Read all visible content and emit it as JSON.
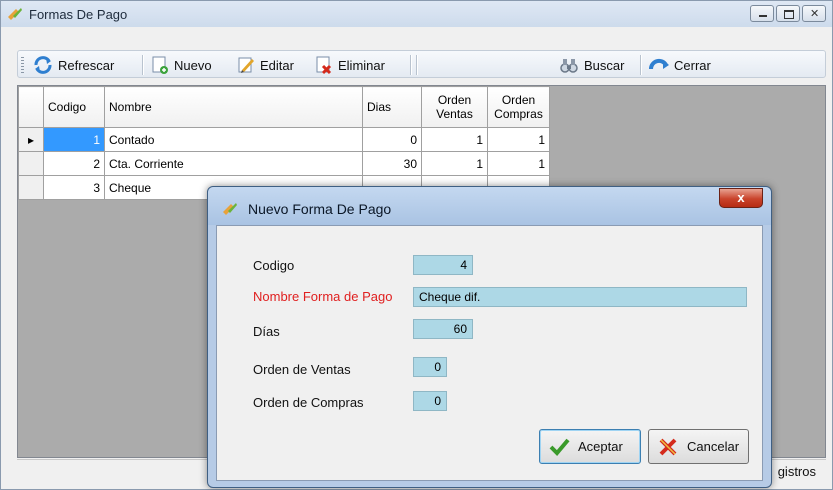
{
  "window": {
    "title": "Formas De Pago"
  },
  "toolbar": {
    "refresh_label": "Refrescar",
    "new_label": "Nuevo",
    "edit_label": "Editar",
    "delete_label": "Eliminar",
    "search_label": "Buscar",
    "close_label": "Cerrar"
  },
  "grid": {
    "columns": [
      "Codigo",
      "Nombre",
      "Dias",
      "Orden Ventas",
      "Orden Compras"
    ],
    "rows": [
      {
        "codigo": "1",
        "nombre": "Contado",
        "dias": "0",
        "orden_ventas": "1",
        "orden_compras": "1"
      },
      {
        "codigo": "2",
        "nombre": "Cta. Corriente",
        "dias": "30",
        "orden_ventas": "1",
        "orden_compras": "1"
      },
      {
        "codigo": "3",
        "nombre": "Cheque",
        "dias": "",
        "orden_ventas": "",
        "orden_compras": ""
      }
    ]
  },
  "status": {
    "text": "gistros"
  },
  "dialog": {
    "title": "Nuevo Forma De Pago",
    "close_glyph": "x",
    "fields": {
      "codigo": {
        "label": "Codigo",
        "value": "4"
      },
      "nombre": {
        "label": "Nombre Forma de Pago",
        "value": "Cheque dif."
      },
      "dias": {
        "label": "Días",
        "value": "60"
      },
      "orden_ventas": {
        "label": "Orden de Ventas",
        "value": "0"
      },
      "orden_compras": {
        "label": "Orden de Compras",
        "value": "0"
      }
    },
    "accept_label": "Aceptar",
    "cancel_label": "Cancelar"
  },
  "colors": {
    "required_label": "#e02020",
    "field_bg": "#add8e6",
    "selection": "#3399ff"
  },
  "icons": [
    "refresh-icon",
    "new-icon",
    "edit-icon",
    "delete-icon",
    "search-icon",
    "close-arrow-icon",
    "app-icon",
    "check-icon",
    "cancel-x-icon"
  ]
}
